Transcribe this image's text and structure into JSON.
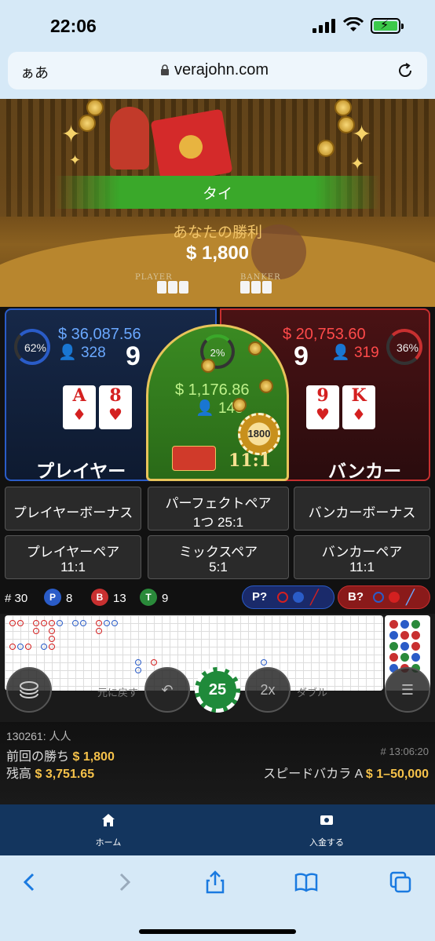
{
  "status": {
    "time": "22:06"
  },
  "browser": {
    "text_size": "ぁあ",
    "domain": "verajohn.com"
  },
  "video": {
    "result_label": "タイ",
    "win_label": "あなたの勝利",
    "win_amount": "$ 1,800",
    "felt_player": "PLAYER",
    "felt_banker": "BANKER"
  },
  "player": {
    "percent": "62%",
    "amount": "$ 36,087.56",
    "bettors": "328",
    "score": "9",
    "cards": [
      {
        "rank": "A",
        "suit": "♦"
      },
      {
        "rank": "8",
        "suit": "♥"
      }
    ],
    "title": "プレイヤー"
  },
  "tie": {
    "percent": "2%",
    "amount": "$ 1,176.86",
    "bettors": "148",
    "chip_value": "1800",
    "payout": "11:1"
  },
  "banker": {
    "percent": "36%",
    "amount": "$ 20,753.60",
    "bettors": "319",
    "score": "9",
    "cards": [
      {
        "rank": "9",
        "suit": "♥"
      },
      {
        "rank": "K",
        "suit": "♦"
      }
    ],
    "title": "バンカー"
  },
  "side_bets": {
    "player_bonus": "プレイヤーボーナス",
    "perfect_pair": "パーフェクトペア",
    "perfect_pair_odds": "1つ 25:1",
    "banker_bonus": "バンカーボーナス",
    "player_pair": "プレイヤーペア",
    "player_pair_odds": "11:1",
    "mixed_pair": "ミックスペア",
    "mixed_pair_odds": "5:1",
    "banker_pair": "バンカーペア",
    "banker_pair_odds": "11:1"
  },
  "stats": {
    "rounds_label": "# 30",
    "p_label": "P",
    "p_count": "8",
    "b_label": "B",
    "b_count": "13",
    "t_label": "T",
    "t_count": "9",
    "player_predict": "P?",
    "banker_predict": "B?"
  },
  "controls": {
    "undo_label": "元に戻す",
    "chip_value": "25",
    "double_label": "ダブル",
    "double_icon": "2x"
  },
  "info": {
    "user": "130261: 人人",
    "last_win_label": "前回の勝ち",
    "last_win_amount": "$ 1,800",
    "balance_label": "残高",
    "balance_amount": "$ 3,751.65",
    "round_id": "# 13:06:20",
    "table_name": "スピードバカラ A",
    "limits": "$ 1–50,000"
  },
  "nav": {
    "home": "ホーム",
    "deposit": "入金する"
  },
  "colors": {
    "player": "#2a5cc8",
    "banker": "#c83030",
    "tie": "#3aa82a",
    "gold": "#f6c24a"
  }
}
